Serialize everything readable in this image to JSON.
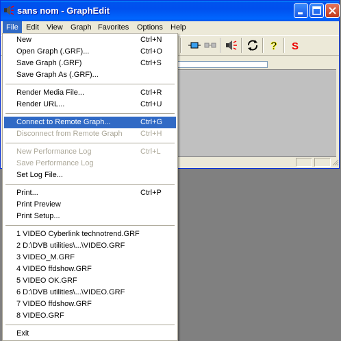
{
  "window": {
    "title": "sans nom - GraphEdit"
  },
  "menubar": {
    "items": [
      {
        "label": "File"
      },
      {
        "label": "Edit"
      },
      {
        "label": "View"
      },
      {
        "label": "Graph"
      },
      {
        "label": "Favorites"
      },
      {
        "label": "Options"
      },
      {
        "label": "Help"
      }
    ]
  },
  "toolbar": {
    "icons": [
      "connect-pins-icon",
      "disconnect-icon",
      "speaker-icon",
      "refresh-icon",
      "help-icon",
      "s-icon"
    ]
  },
  "file_menu": {
    "items": [
      {
        "label": "New",
        "shortcut": "Ctrl+N"
      },
      {
        "label": "Open Graph (.GRF)...",
        "shortcut": "Ctrl+O"
      },
      {
        "label": "Save Graph (.GRF)",
        "shortcut": "Ctrl+S"
      },
      {
        "label": "Save Graph As (.GRF)...",
        "shortcut": ""
      },
      {
        "label": "Render Media File...",
        "shortcut": "Ctrl+R"
      },
      {
        "label": "Render URL...",
        "shortcut": "Ctrl+U"
      },
      {
        "label": "Connect to Remote Graph...",
        "shortcut": "Ctrl+G"
      },
      {
        "label": "Disconnect from Remote Graph",
        "shortcut": "Ctrl+H"
      },
      {
        "label": "New Performance Log",
        "shortcut": "Ctrl+L"
      },
      {
        "label": "Save Performance Log",
        "shortcut": ""
      },
      {
        "label": "Set Log File...",
        "shortcut": ""
      },
      {
        "label": "Print...",
        "shortcut": "Ctrl+P"
      },
      {
        "label": "Print Preview",
        "shortcut": ""
      },
      {
        "label": "Print Setup...",
        "shortcut": ""
      },
      {
        "label": "1 VIDEO Cyberlink technotrend.GRF",
        "shortcut": ""
      },
      {
        "label": "2 D:\\DVB utilities\\...\\VIDEO.GRF",
        "shortcut": ""
      },
      {
        "label": "3 VIDEO_M.GRF",
        "shortcut": ""
      },
      {
        "label": "4 VIDEO ffdshow.GRF",
        "shortcut": ""
      },
      {
        "label": "5 VIDEO OK.GRF",
        "shortcut": ""
      },
      {
        "label": "6 D:\\DVB utilities\\...\\VIDEO.GRF",
        "shortcut": ""
      },
      {
        "label": "7 VIDEO ffdshow.GRF",
        "shortcut": ""
      },
      {
        "label": "8 VIDEO.GRF",
        "shortcut": ""
      },
      {
        "label": "Exit",
        "shortcut": ""
      }
    ]
  },
  "colors": {
    "titlebar": "#0055ea",
    "highlight": "#316ac5",
    "disabled_text": "#aca899",
    "desktop": "#808080"
  }
}
